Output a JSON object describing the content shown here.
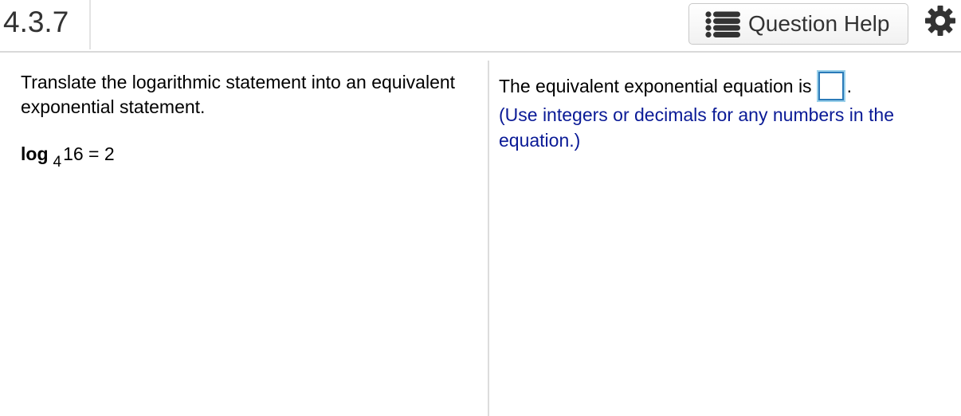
{
  "header": {
    "question_number": "4.3.7",
    "help_button_label": "Question Help",
    "help_icon": "list-icon",
    "settings_icon": "gear-icon"
  },
  "left": {
    "instruction": "Translate the logarithmic statement into an equivalent exponential statement.",
    "expression": {
      "log_word": "log",
      "base": "4",
      "rest": "16 = 2"
    }
  },
  "right": {
    "prompt": "The equivalent exponential equation is",
    "answer_value": "",
    "after_box": ".",
    "hint": "(Use integers or decimals for any numbers in the equation.)"
  },
  "colors": {
    "hint_text": "#0a1a96",
    "answer_box_border": "#2a7ab8"
  }
}
